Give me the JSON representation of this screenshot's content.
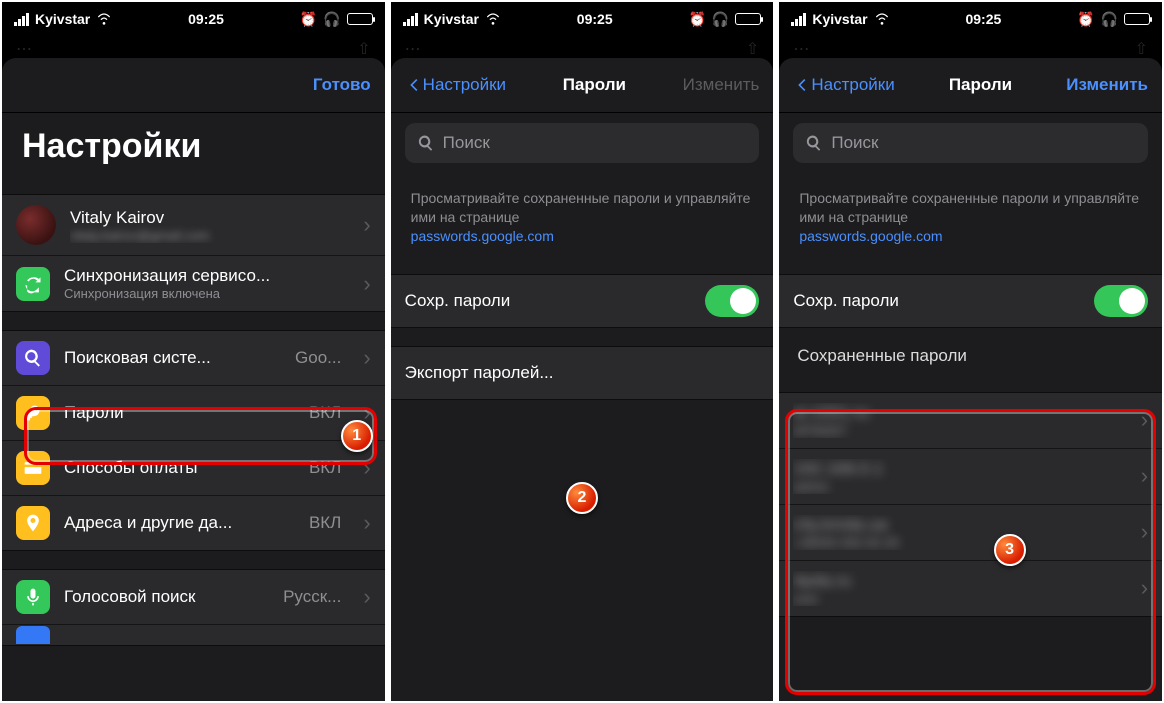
{
  "status": {
    "carrier": "Kyivstar",
    "time": "09:25"
  },
  "screen1": {
    "done": "Готово",
    "title": "Настройки",
    "profile": {
      "name": "Vitaly Kairov",
      "email": "vitaly.kairov@gmail.com"
    },
    "sync": {
      "label": "Синхронизация сервисо...",
      "sub": "Синхронизация включена"
    },
    "search_engine": {
      "label": "Поисковая систе...",
      "value": "Goo..."
    },
    "passwords": {
      "label": "Пароли",
      "value": "ВКЛ"
    },
    "payments": {
      "label": "Способы оплаты",
      "value": "ВКЛ"
    },
    "addresses": {
      "label": "Адреса и другие да...",
      "value": "ВКЛ"
    },
    "voice": {
      "label": "Голосовой поиск",
      "value": "Русск..."
    }
  },
  "screen2": {
    "back": "Настройки",
    "title": "Пароли",
    "edit": "Изменить",
    "search_placeholder": "Поиск",
    "info_line1": "Просматривайте сохраненные пароли и управляйте ими на странице",
    "info_link": "passwords.google.com",
    "save_passwords": "Сохр. пароли",
    "export": "Экспорт паролей..."
  },
  "screen3": {
    "back": "Настройки",
    "title": "Пароли",
    "edit": "Изменить",
    "search_placeholder": "Поиск",
    "info_line1": "Просматривайте сохраненные пароли и управляйте ими на странице",
    "info_link": "passwords.google.com",
    "save_passwords": "Сохр. пароли",
    "saved_header": "Сохраненные пароли",
    "items": [
      {
        "site": "ai.1001.ru",
        "user": "AP49307"
      },
      {
        "site": "192.168.0.1",
        "user": "admin"
      },
      {
        "site": "city.kmda.ua",
        "user": "+38050 000 00 29"
      },
      {
        "site": "4pda.ru",
        "user": "user"
      }
    ]
  },
  "markers": {
    "m1": "1",
    "m2": "2",
    "m3": "3"
  }
}
